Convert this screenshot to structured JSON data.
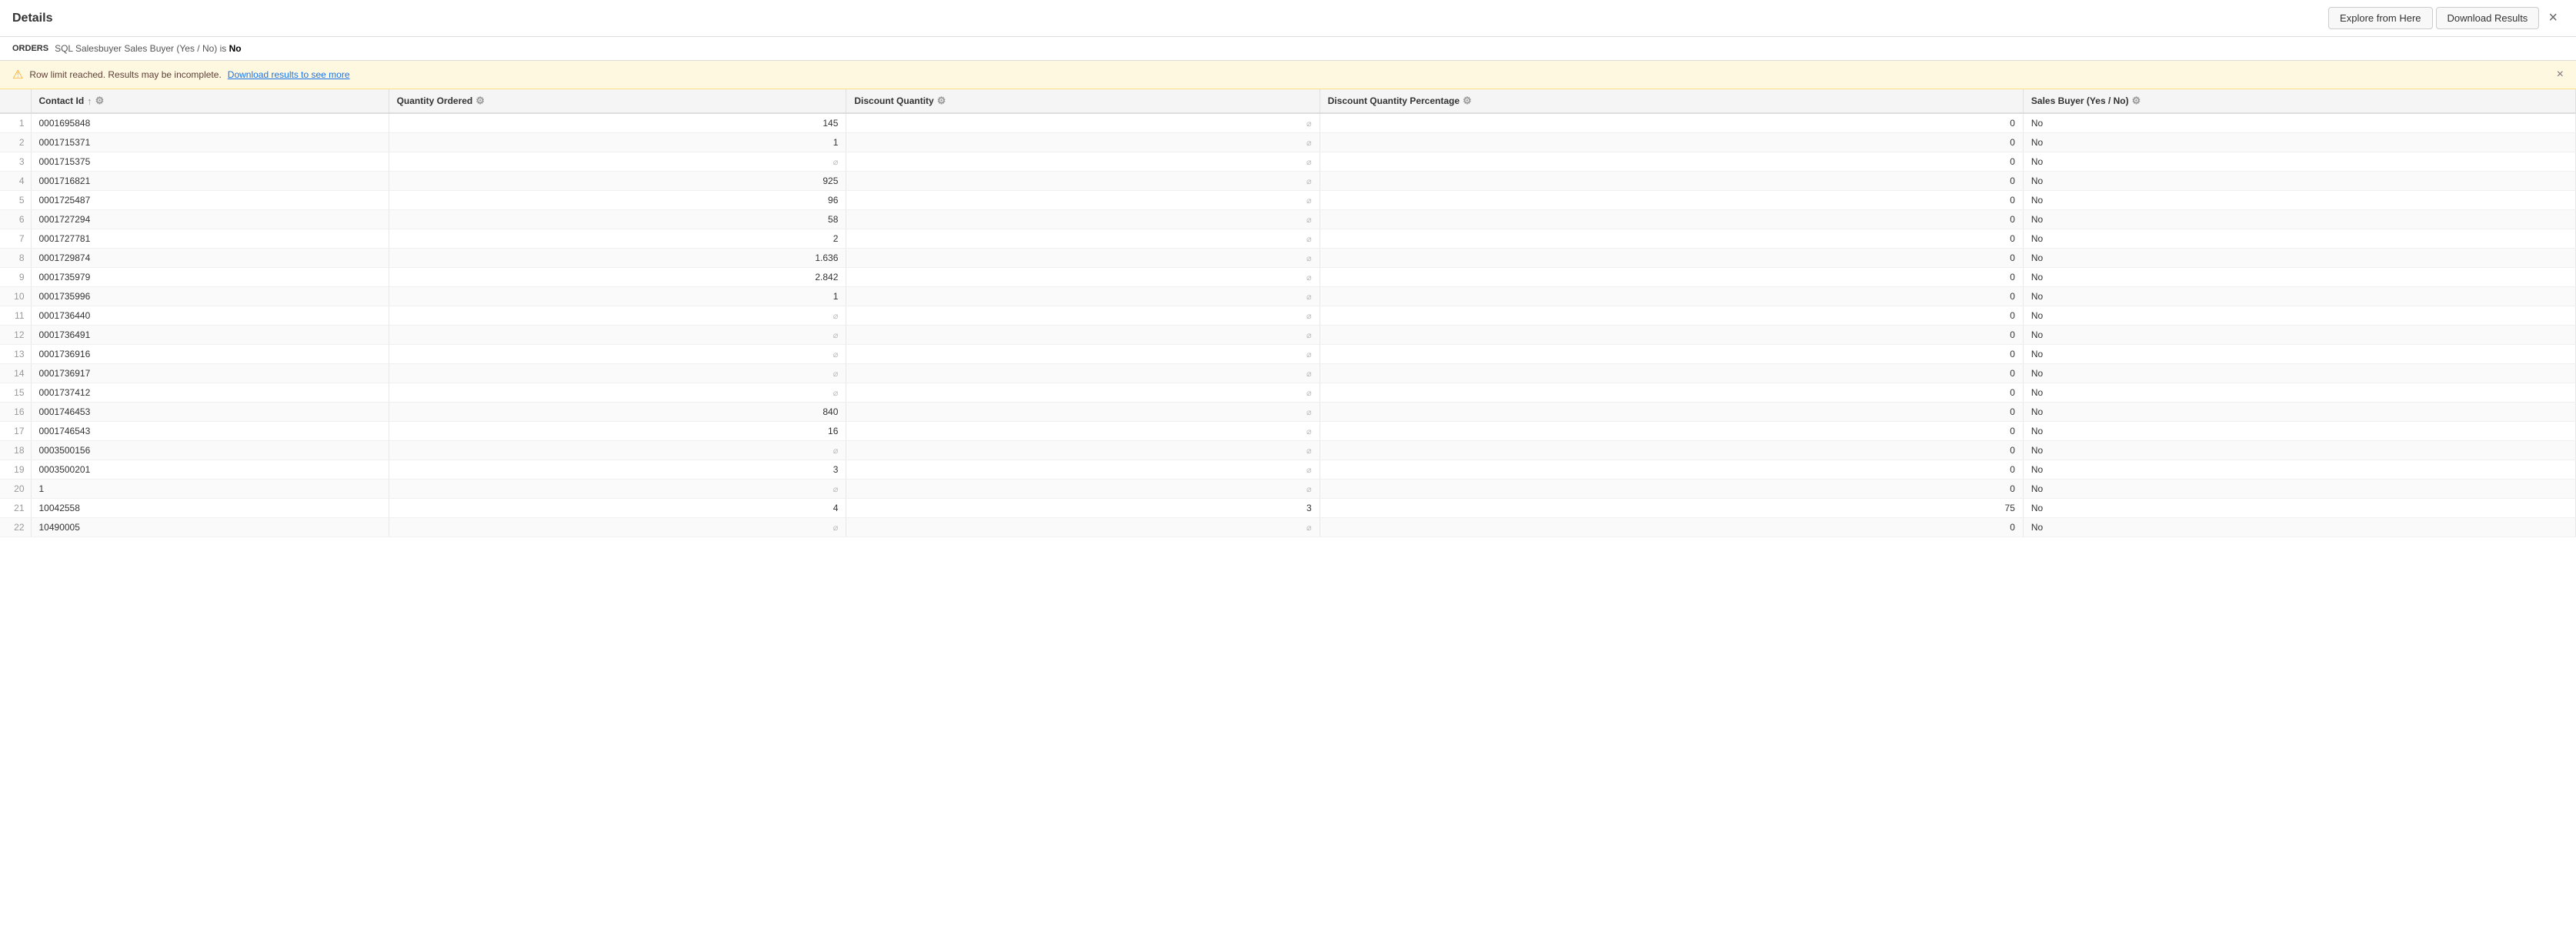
{
  "header": {
    "title": "Details",
    "explore_label": "Explore from Here",
    "download_label": "Download Results",
    "close_label": "×"
  },
  "orders_bar": {
    "label": "ORDERS",
    "sql_text": "SQL Salesbuyer Sales Buyer (Yes / No) is No"
  },
  "warning": {
    "icon": "⚠",
    "text": "Row limit reached. Results may be incomplete.",
    "link_text": "Download results to see more",
    "close": "×"
  },
  "columns": [
    {
      "id": "row_num",
      "label": "",
      "has_gear": false,
      "has_sort": false
    },
    {
      "id": "contact_id",
      "label": "Contact Id",
      "has_gear": true,
      "has_sort": true
    },
    {
      "id": "quantity_ordered",
      "label": "Quantity Ordered",
      "has_gear": true,
      "has_sort": false
    },
    {
      "id": "discount_quantity",
      "label": "Discount Quantity",
      "has_gear": true,
      "has_sort": false
    },
    {
      "id": "discount_quantity_pct",
      "label": "Discount Quantity Percentage",
      "has_gear": true,
      "has_sort": false
    },
    {
      "id": "sales_buyer",
      "label": "Sales Buyer (Yes / No)",
      "has_gear": true,
      "has_sort": false
    }
  ],
  "rows": [
    {
      "row": 1,
      "contact_id": "0001695848",
      "quantity_ordered": "145",
      "discount_quantity": null,
      "discount_qty_pct": "0",
      "sales_buyer": "No"
    },
    {
      "row": 2,
      "contact_id": "0001715371",
      "quantity_ordered": "1",
      "discount_quantity": null,
      "discount_qty_pct": "0",
      "sales_buyer": "No"
    },
    {
      "row": 3,
      "contact_id": "0001715375",
      "quantity_ordered": null,
      "discount_quantity": null,
      "discount_qty_pct": "0",
      "sales_buyer": "No"
    },
    {
      "row": 4,
      "contact_id": "0001716821",
      "quantity_ordered": "925",
      "discount_quantity": null,
      "discount_qty_pct": "0",
      "sales_buyer": "No"
    },
    {
      "row": 5,
      "contact_id": "0001725487",
      "quantity_ordered": "96",
      "discount_quantity": null,
      "discount_qty_pct": "0",
      "sales_buyer": "No"
    },
    {
      "row": 6,
      "contact_id": "0001727294",
      "quantity_ordered": "58",
      "discount_quantity": null,
      "discount_qty_pct": "0",
      "sales_buyer": "No"
    },
    {
      "row": 7,
      "contact_id": "0001727781",
      "quantity_ordered": "2",
      "discount_quantity": null,
      "discount_qty_pct": "0",
      "sales_buyer": "No"
    },
    {
      "row": 8,
      "contact_id": "0001729874",
      "quantity_ordered": "1.636",
      "discount_quantity": null,
      "discount_qty_pct": "0",
      "sales_buyer": "No"
    },
    {
      "row": 9,
      "contact_id": "0001735979",
      "quantity_ordered": "2.842",
      "discount_quantity": null,
      "discount_qty_pct": "0",
      "sales_buyer": "No"
    },
    {
      "row": 10,
      "contact_id": "0001735996",
      "quantity_ordered": "1",
      "discount_quantity": null,
      "discount_qty_pct": "0",
      "sales_buyer": "No"
    },
    {
      "row": 11,
      "contact_id": "0001736440",
      "quantity_ordered": null,
      "discount_quantity": null,
      "discount_qty_pct": "0",
      "sales_buyer": "No"
    },
    {
      "row": 12,
      "contact_id": "0001736491",
      "quantity_ordered": null,
      "discount_quantity": null,
      "discount_qty_pct": "0",
      "sales_buyer": "No"
    },
    {
      "row": 13,
      "contact_id": "0001736916",
      "quantity_ordered": null,
      "discount_quantity": null,
      "discount_qty_pct": "0",
      "sales_buyer": "No"
    },
    {
      "row": 14,
      "contact_id": "0001736917",
      "quantity_ordered": null,
      "discount_quantity": null,
      "discount_qty_pct": "0",
      "sales_buyer": "No"
    },
    {
      "row": 15,
      "contact_id": "0001737412",
      "quantity_ordered": null,
      "discount_quantity": null,
      "discount_qty_pct": "0",
      "sales_buyer": "No"
    },
    {
      "row": 16,
      "contact_id": "0001746453",
      "quantity_ordered": "840",
      "discount_quantity": null,
      "discount_qty_pct": "0",
      "sales_buyer": "No"
    },
    {
      "row": 17,
      "contact_id": "0001746543",
      "quantity_ordered": "16",
      "discount_quantity": null,
      "discount_qty_pct": "0",
      "sales_buyer": "No"
    },
    {
      "row": 18,
      "contact_id": "0003500156",
      "quantity_ordered": null,
      "discount_quantity": null,
      "discount_qty_pct": "0",
      "sales_buyer": "No"
    },
    {
      "row": 19,
      "contact_id": "0003500201",
      "quantity_ordered": "3",
      "discount_quantity": null,
      "discount_qty_pct": "0",
      "sales_buyer": "No"
    },
    {
      "row": 20,
      "contact_id": "1",
      "quantity_ordered": null,
      "discount_quantity": null,
      "discount_qty_pct": "0",
      "sales_buyer": "No"
    },
    {
      "row": 21,
      "contact_id": "10042558",
      "quantity_ordered": "4",
      "discount_quantity": "3",
      "discount_qty_pct": "75",
      "sales_buyer": "No"
    },
    {
      "row": 22,
      "contact_id": "10490005",
      "quantity_ordered": null,
      "discount_quantity": null,
      "discount_qty_pct": "0",
      "sales_buyer": "No"
    }
  ],
  "null_symbol": "⌀"
}
